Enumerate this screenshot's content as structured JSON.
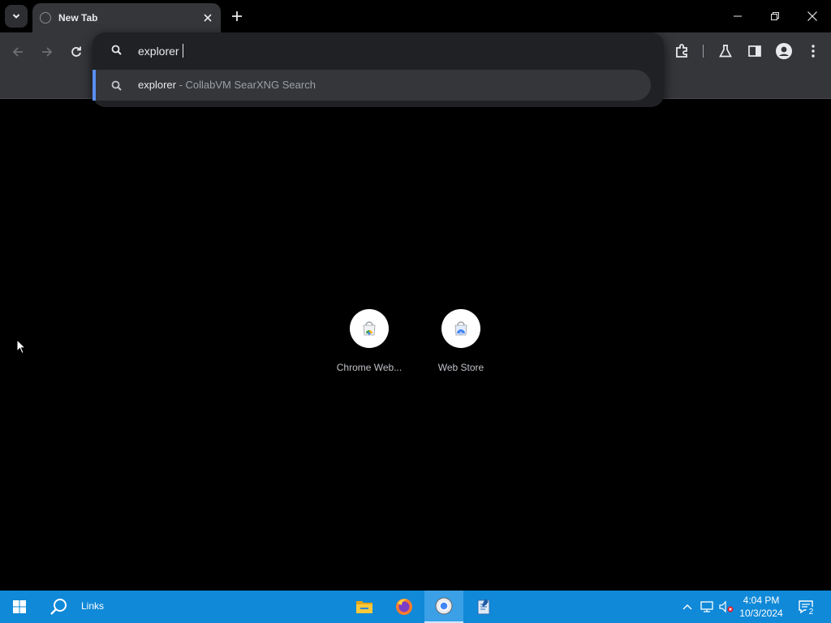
{
  "browser": {
    "tab": {
      "title": "New Tab"
    },
    "omnibox": {
      "text": "explorer "
    },
    "suggestion": {
      "query": "explorer",
      "separator": " - ",
      "engine": "CollabVM SearXNG Search"
    },
    "colors": {
      "accent": "#5a8ff0",
      "toolbar": "#35363a",
      "popup": "#202124"
    }
  },
  "shortcuts": [
    {
      "label": "Chrome Web...",
      "icon": "chrome-web-store-icon"
    },
    {
      "label": "Web Store",
      "icon": "web-store-icon"
    }
  ],
  "taskbar": {
    "search_label": "Links",
    "apps": [
      "file-explorer-icon",
      "firefox-icon",
      "chrome-icon",
      "notepad-icon"
    ],
    "clock": {
      "time": "4:04 PM",
      "date": "10/3/2024"
    },
    "notifications": "2",
    "color": "#1089d8"
  }
}
